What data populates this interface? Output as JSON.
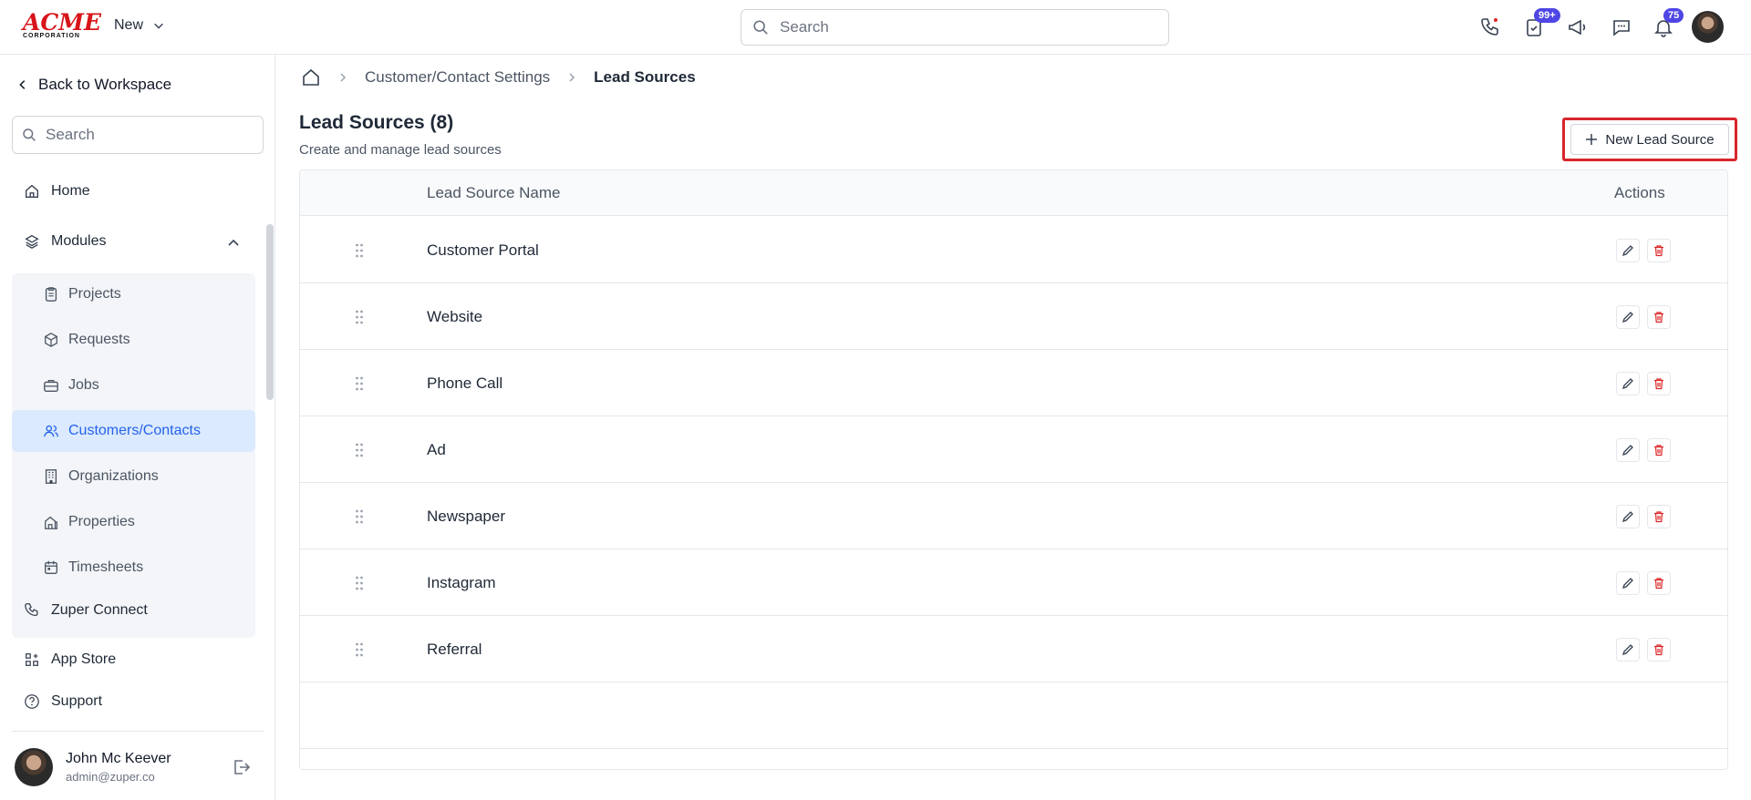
{
  "header": {
    "logo_text": "ACME",
    "logo_sub": "CORPORATION",
    "new_label": "New",
    "search_placeholder": "Search",
    "tasks_badge": "99+",
    "notifications_badge": "75"
  },
  "sidebar": {
    "back_label": "Back to Workspace",
    "search_placeholder": "Search",
    "home_label": "Home",
    "modules_label": "Modules",
    "modules": [
      {
        "label": "Projects",
        "icon": "clipboard-icon"
      },
      {
        "label": "Requests",
        "icon": "package-icon"
      },
      {
        "label": "Jobs",
        "icon": "briefcase-icon"
      },
      {
        "label": "Customers/Contacts",
        "icon": "users-icon",
        "active": true
      },
      {
        "label": "Organizations",
        "icon": "building-icon"
      },
      {
        "label": "Properties",
        "icon": "property-icon"
      },
      {
        "label": "Timesheets",
        "icon": "calendar-icon"
      }
    ],
    "connect_label": "Zuper Connect",
    "appstore_label": "App Store",
    "support_label": "Support",
    "user_name": "John Mc Keever",
    "user_email": "admin@zuper.co"
  },
  "breadcrumb": {
    "parent": "Customer/Contact Settings",
    "current": "Lead Sources"
  },
  "page": {
    "title": "Lead Sources (8)",
    "subtitle": "Create and manage lead sources",
    "new_button": "New Lead Source"
  },
  "table": {
    "col_name": "Lead Source Name",
    "col_actions": "Actions",
    "rows": [
      "Customer Portal",
      "Website",
      "Phone Call",
      "Ad",
      "Newspaper",
      "Instagram",
      "Referral"
    ]
  },
  "colors": {
    "accent": "#2563eb",
    "highlight": "#d7262b",
    "delete": "#dc2626",
    "badge": "#4f46e5"
  }
}
